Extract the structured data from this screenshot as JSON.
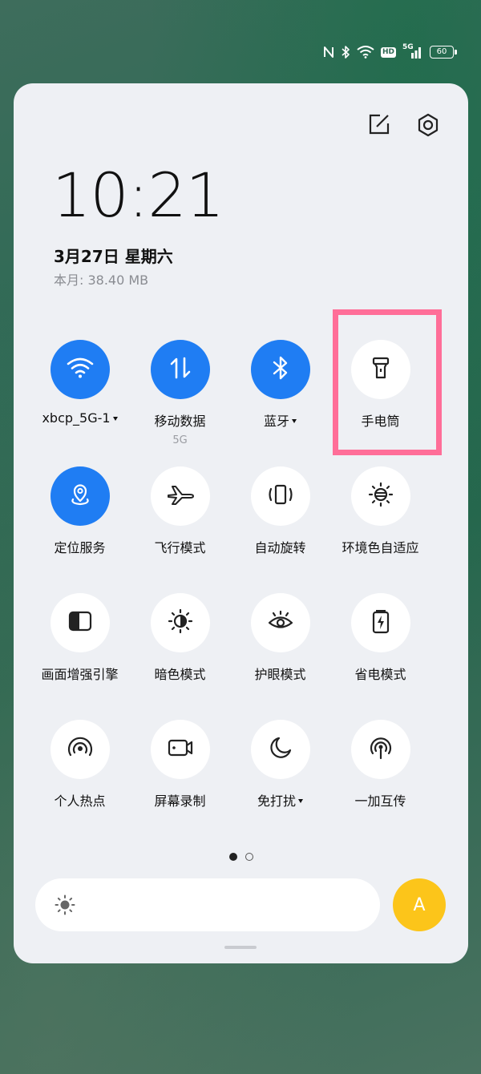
{
  "status_bar": {
    "hd": "HD",
    "network": "5G",
    "battery": "60"
  },
  "clock": {
    "time": "10:21",
    "date": "3月27日  星期六",
    "usage": "本月: 38.40 MB"
  },
  "tiles": [
    {
      "label": "xbcp_5G-1",
      "icon": "wifi-icon",
      "active": true,
      "caret": true,
      "sub": ""
    },
    {
      "label": "移动数据",
      "icon": "mobile-data-icon",
      "active": true,
      "caret": false,
      "sub": "5G"
    },
    {
      "label": "蓝牙",
      "icon": "bluetooth-icon",
      "active": true,
      "caret": true,
      "sub": ""
    },
    {
      "label": "手电筒",
      "icon": "flashlight-icon",
      "active": false,
      "caret": false,
      "sub": ""
    },
    {
      "label": "定位服务",
      "icon": "location-icon",
      "active": true,
      "caret": false,
      "sub": ""
    },
    {
      "label": "飞行模式",
      "icon": "airplane-icon",
      "active": false,
      "caret": false,
      "sub": ""
    },
    {
      "label": "自动旋转",
      "icon": "auto-rotate-icon",
      "active": false,
      "caret": false,
      "sub": ""
    },
    {
      "label": "环境色自适应",
      "icon": "ambient-color-icon",
      "active": false,
      "caret": false,
      "sub": ""
    },
    {
      "label": "画面增强引擎",
      "icon": "display-enhance-icon",
      "active": false,
      "caret": false,
      "sub": ""
    },
    {
      "label": "暗色模式",
      "icon": "dark-mode-icon",
      "active": false,
      "caret": false,
      "sub": ""
    },
    {
      "label": "护眼模式",
      "icon": "eye-comfort-icon",
      "active": false,
      "caret": false,
      "sub": ""
    },
    {
      "label": "省电模式",
      "icon": "battery-saver-icon",
      "active": false,
      "caret": false,
      "sub": ""
    },
    {
      "label": "个人热点",
      "icon": "hotspot-icon",
      "active": false,
      "caret": false,
      "sub": ""
    },
    {
      "label": "屏幕录制",
      "icon": "screen-record-icon",
      "active": false,
      "caret": false,
      "sub": ""
    },
    {
      "label": "免打扰",
      "icon": "do-not-disturb-icon",
      "active": false,
      "caret": true,
      "sub": ""
    },
    {
      "label": "一加互传",
      "icon": "oneplus-share-icon",
      "active": false,
      "caret": false,
      "sub": ""
    }
  ],
  "pager": {
    "pages": 2,
    "current": 1
  },
  "brightness": {
    "icon": "sun-icon"
  },
  "avatar": {
    "initial": "A",
    "color": "#fcc51a"
  },
  "colors": {
    "accent": "#1f7df3",
    "highlight": "#ff6e98",
    "panel": "#eef0f4"
  }
}
